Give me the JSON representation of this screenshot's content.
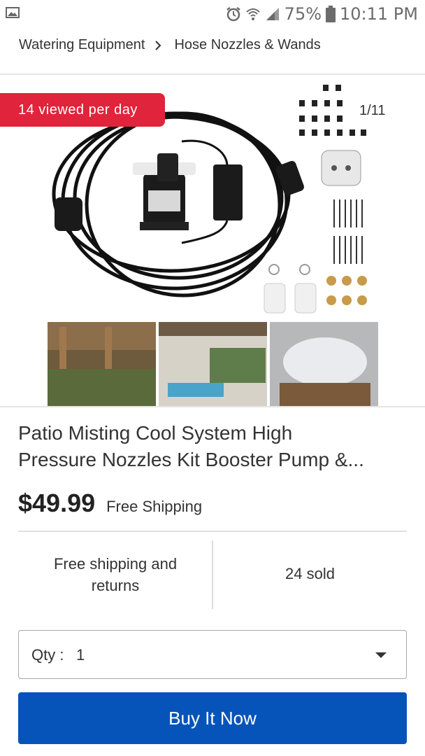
{
  "status_bar": {
    "battery": "75%",
    "time": "10:11 PM",
    "icons": [
      "gallery-icon",
      "alarm-icon",
      "wifi-icon",
      "signal-icon",
      "battery-icon"
    ]
  },
  "breadcrumb": {
    "items": [
      "Watering Equipment",
      "Hose Nozzles & Wands"
    ]
  },
  "gallery": {
    "badge": "14 viewed per day",
    "counter": "1/11"
  },
  "product": {
    "title_line1": "Patio Misting Cool System High",
    "title_line2": "Pressure Nozzles Kit Booster Pump &...",
    "price": "$49.99",
    "shipping": "Free Shipping"
  },
  "info": {
    "left_line1": "Free shipping and",
    "left_line2": "returns",
    "right": "24 sold"
  },
  "qty": {
    "label": "Qty :",
    "value": "1"
  },
  "buy_button": "Buy It Now",
  "colors": {
    "badge_red": "#e0243b",
    "buy_blue": "#0654ba"
  }
}
